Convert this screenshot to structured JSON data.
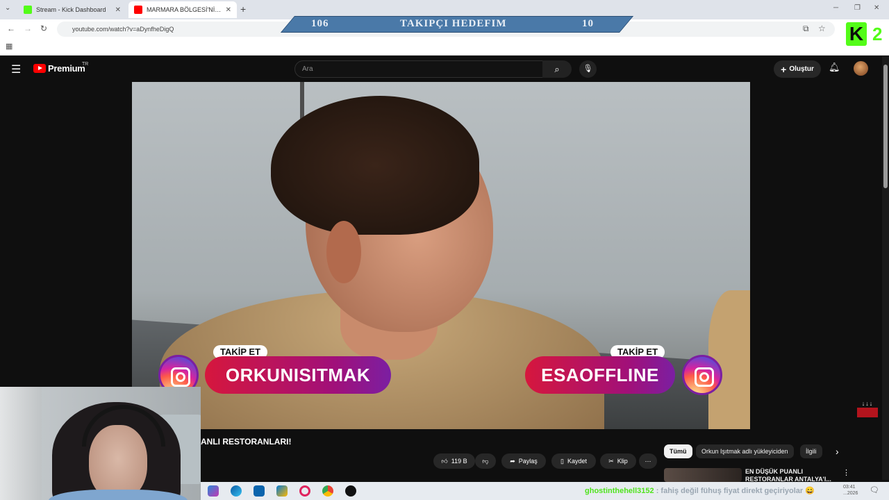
{
  "browser": {
    "tabs": [
      {
        "label": "Stream - Kick Dashboard",
        "favicon_color": "#53fc18"
      },
      {
        "label": "MARMARA BÖLGESİ'NİN EN D...",
        "favicon_color": "#ff0000"
      }
    ],
    "url": "youtube.com/watch?v=aDynfheDigQ"
  },
  "goal_overlay": {
    "current": "106",
    "label": "TAKIPÇI HEDEFIM",
    "target": "10"
  },
  "kick_badge": {
    "letter": "K",
    "number": "2"
  },
  "youtube": {
    "brand": "Premium",
    "region": "TR",
    "search_placeholder": "Ara",
    "create_label": "Oluştur"
  },
  "overlay": {
    "follow_label_left": "TAKİP ET",
    "instagram_left": "ORKUNISITMAK",
    "follow_label_right": "TAKİP ET",
    "instagram_right": "ESAOFFLINE"
  },
  "video": {
    "title": "ANLI RESTORANLARI!",
    "actions": {
      "likes": "119 B",
      "share": "Paylaş",
      "save": "Kaydet",
      "clip": "Klip"
    }
  },
  "recommendations": {
    "chips": [
      "Tümü",
      "Orkun Işıtmak adlı yükleyiciden",
      "İlgili"
    ],
    "first_title": "EN DÜŞÜK PUANLI RESTORANLAR ANTALYA'I..."
  },
  "chat_overlay": {
    "username": "ghostinthehell3152",
    "message": ": fahiş değil fühuş fiyat direkt geçiriyolar 😄"
  },
  "tray": {
    "time": "03:41",
    "date": "...2026"
  },
  "colors": {
    "kick_green": "#53fc18",
    "yt_red": "#ff0000",
    "goal_blue": "#4a79a8"
  }
}
